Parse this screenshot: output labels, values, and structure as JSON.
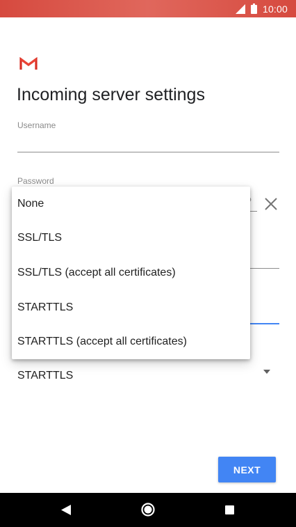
{
  "status_bar": {
    "time": "10:00",
    "icons": [
      "signal-icon",
      "battery-icon"
    ],
    "background_color": "#d64a3f"
  },
  "app": {
    "logo_icon": "gmail-logo-icon",
    "page_title": "Incoming server settings"
  },
  "form": {
    "username_label": "Username",
    "username_value": "",
    "password_label": "Password",
    "password_partial": "?",
    "security_type_value": "STARTTLS"
  },
  "dropdown": {
    "options": [
      "None",
      "SSL/TLS",
      "SSL/TLS (accept all certificates)",
      "STARTTLS",
      "STARTTLS (accept all certificates)"
    ]
  },
  "actions": {
    "next_label": "NEXT",
    "accent_color": "#4285f4"
  },
  "nav_bar": {
    "icons": [
      "back-icon",
      "home-icon",
      "recents-icon"
    ]
  }
}
